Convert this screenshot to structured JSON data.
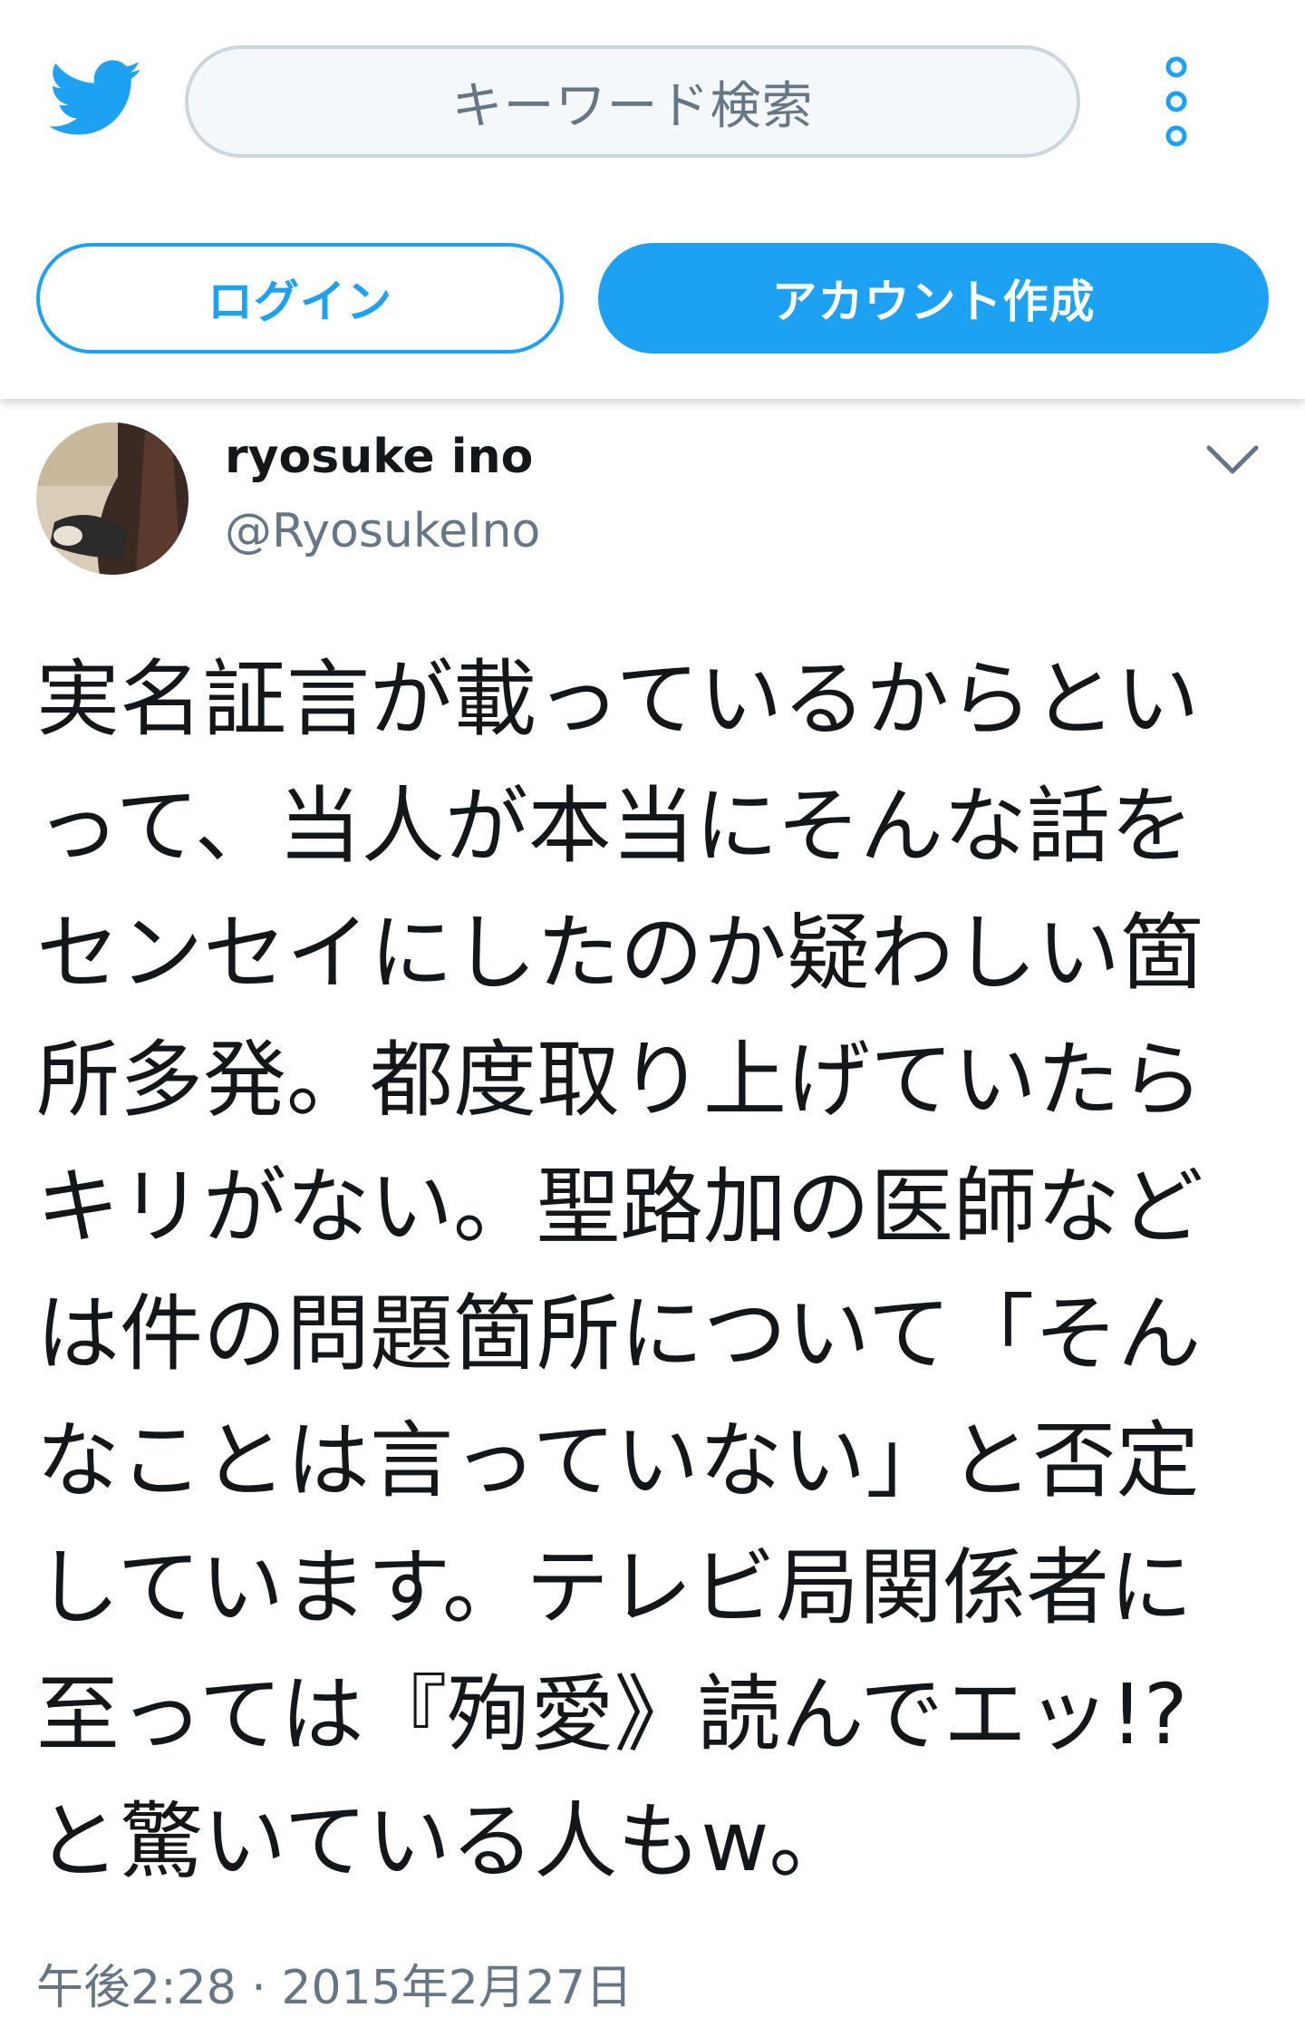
{
  "colors": {
    "brand": "#1da1f2",
    "text": "#14171a",
    "secondary_text": "#657786",
    "search_bg": "#f5f8fa",
    "search_border": "#ccd6dd"
  },
  "header": {
    "logo_icon": "twitter-bird-icon",
    "search": {
      "placeholder": "キーワード検索"
    },
    "more_icon": "vertical-dots-icon",
    "login_label": "ログイン",
    "signup_label": "アカウント作成"
  },
  "tweet": {
    "author": {
      "name": "ryosuke ino",
      "handle": "@RyosukeIno"
    },
    "menu_icon": "chevron-down-icon",
    "text_lines": [
      "実名証言が載っているからとい",
      "って、当人が本当にそんな話を",
      "センセイにしたのか疑わしい箇",
      "所多発。都度取り上げていたら",
      "キリがない。聖路加の医師など",
      "は件の問題箇所について「そん",
      "なことは言っていない」と否定",
      "しています。テレビ局関係者に",
      "至っては『殉愛》読んでエッ!?",
      "と驚いている人もw。"
    ],
    "timestamp": "午後2:28 · 2015年2月27日"
  }
}
